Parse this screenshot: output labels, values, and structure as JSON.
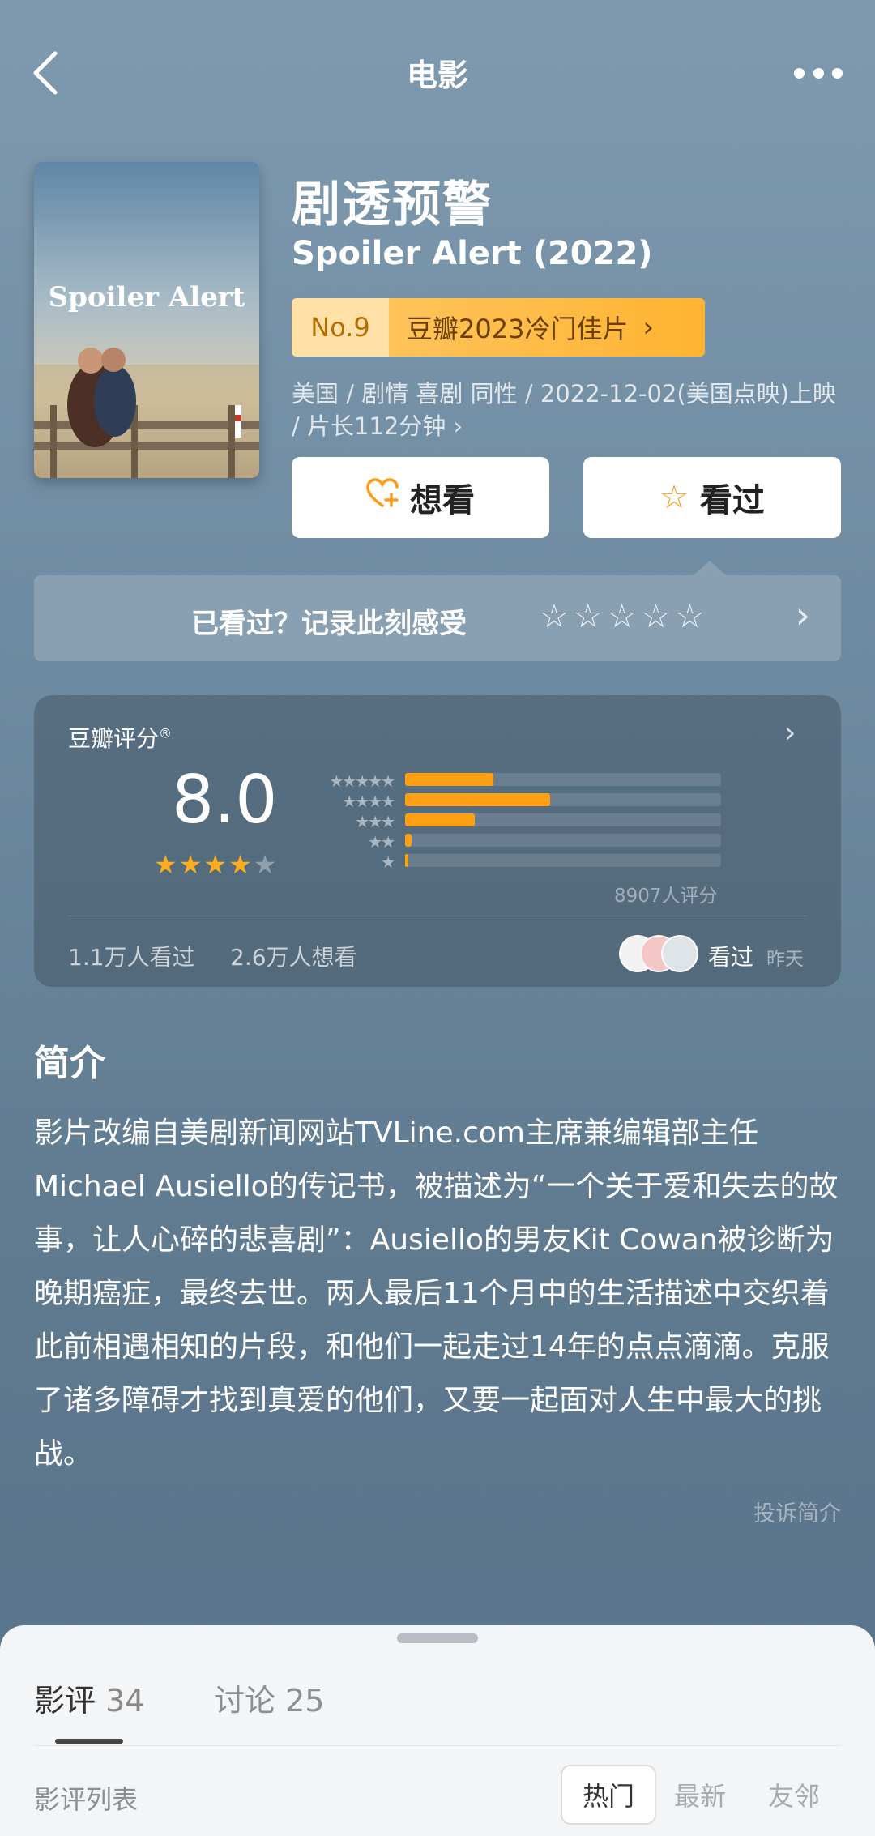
{
  "header": {
    "title": "电影"
  },
  "movie": {
    "title_cn": "剧透预警",
    "title_en": "Spoiler Alert (2022)",
    "rank_no": "No.9",
    "rank_text": "豆瓣2023冷门佳片",
    "meta": "美国 / 剧情 喜剧 同性 / 2022-12-02(美国点映)上映 / 片长112分钟 ›",
    "want_label": "想看",
    "seen_label": "看过"
  },
  "record": {
    "prompt": "已看过？记录此刻感受",
    "stars": "☆☆☆☆☆"
  },
  "rating": {
    "label": "豆瓣评分",
    "score": "8.0",
    "score_stars": 4,
    "distribution": [
      {
        "label": "★★★★★",
        "percent": 28
      },
      {
        "label": "★★★★",
        "percent": 46
      },
      {
        "label": "★★★",
        "percent": 22
      },
      {
        "label": "★★",
        "percent": 2
      },
      {
        "label": "★",
        "percent": 1
      }
    ],
    "votes": "8907人评分",
    "watched": "1.1万人看过",
    "wanted": "2.6万人想看",
    "friend_action": "看过",
    "friend_time": "昨天"
  },
  "synopsis": {
    "title": "简介",
    "text": "影片改编自美剧新闻网站TVLine.com主席兼编辑部主任Michael Ausiello的传记书，被描述为“一个关于爱和失去的故事，让人心碎的悲喜剧”：Ausiello的男友Kit Cowan被诊断为晚期癌症，最终去世。两人最后11个月中的生活描述中交织着此前相遇相知的片段，和他们一起走过14年的点点滴滴。克服了诸多障碍才找到真爱的他们，又要一起面对人生中最大的挑战。",
    "report": "投诉简介"
  },
  "sheet": {
    "tab_reviews": "影评",
    "tab_reviews_count": "34",
    "tab_discuss": "讨论",
    "tab_discuss_count": "25",
    "list_label": "影评列表",
    "sort_hot": "热门",
    "sort_new": "最新",
    "sort_friends": "友邻"
  },
  "colors": {
    "accent": "#ffa014",
    "rank_bg": "#ffb431"
  }
}
